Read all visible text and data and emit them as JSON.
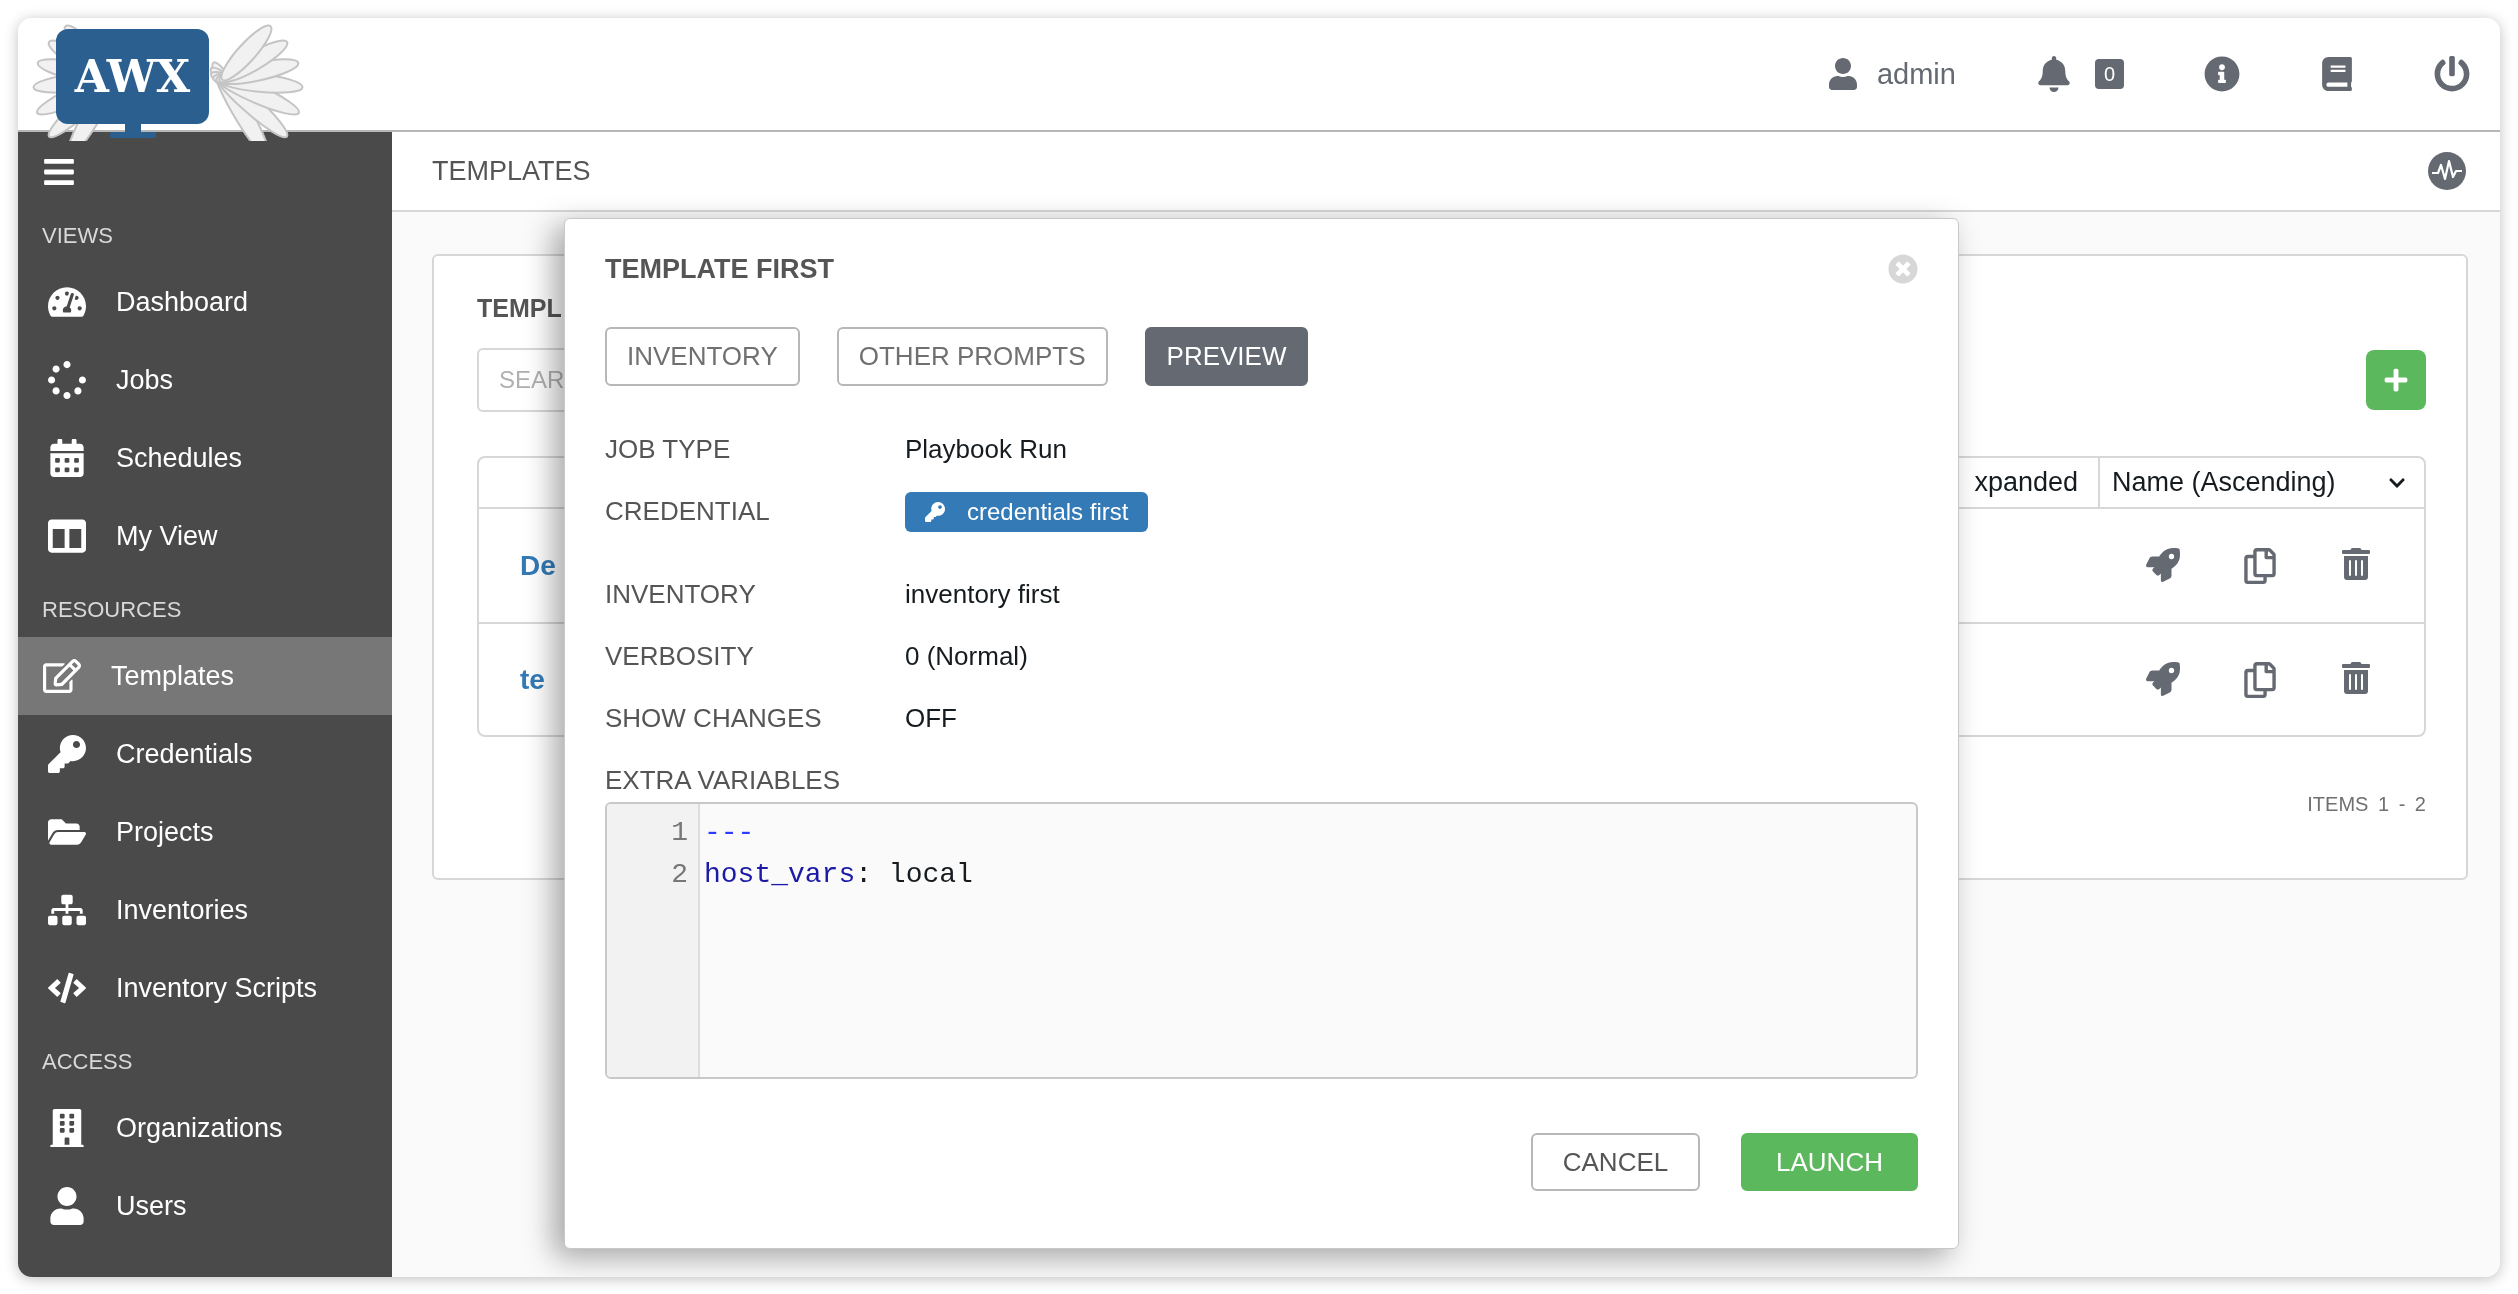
{
  "logo": {
    "text": "AWX"
  },
  "header": {
    "user": "admin",
    "notifications": "0"
  },
  "sidebar": {
    "sections": [
      {
        "title": "VIEWS",
        "items": [
          {
            "label": "Dashboard",
            "selected": false
          },
          {
            "label": "Jobs",
            "selected": false
          },
          {
            "label": "Schedules",
            "selected": false
          },
          {
            "label": "My View",
            "selected": false
          }
        ]
      },
      {
        "title": "RESOURCES",
        "items": [
          {
            "label": "Templates",
            "selected": true
          },
          {
            "label": "Credentials",
            "selected": false
          },
          {
            "label": "Projects",
            "selected": false
          },
          {
            "label": "Inventories",
            "selected": false
          },
          {
            "label": "Inventory Scripts",
            "selected": false
          }
        ]
      },
      {
        "title": "ACCESS",
        "items": [
          {
            "label": "Organizations",
            "selected": false
          },
          {
            "label": "Users",
            "selected": false
          }
        ]
      }
    ]
  },
  "breadcrumb": "TEMPLATES",
  "card": {
    "title": "TEMPL",
    "search": {
      "placeholder": "SEAR"
    },
    "list": {
      "column": "xpanded",
      "sort": "Name (Ascending)",
      "rows": [
        {
          "name": "De"
        },
        {
          "name": "te"
        }
      ]
    },
    "items_label": "ITEMS",
    "items_range": "1 - 2"
  },
  "modal": {
    "title": "TEMPLATE FIRST",
    "tabs": [
      {
        "label": "INVENTORY",
        "selected": false
      },
      {
        "label": "OTHER PROMPTS",
        "selected": false
      },
      {
        "label": "PREVIEW",
        "selected": true
      }
    ],
    "fields": [
      {
        "label": "JOB TYPE",
        "value": "Playbook Run",
        "kind": "text"
      },
      {
        "label": "CREDENTIAL",
        "value": "credentials first",
        "kind": "chip"
      },
      {
        "label": "INVENTORY",
        "value": "inventory first",
        "kind": "text"
      },
      {
        "label": "VERBOSITY",
        "value": "0 (Normal)",
        "kind": "text"
      },
      {
        "label": "SHOW CHANGES",
        "value": "OFF",
        "kind": "text"
      }
    ],
    "extra_variables": {
      "label": "EXTRA VARIABLES",
      "lines": [
        {
          "number": "1",
          "tokens": [
            {
              "text": "---",
              "kind": "marker"
            }
          ]
        },
        {
          "number": "2",
          "tokens": [
            {
              "text": "host_vars",
              "kind": "key"
            },
            {
              "text": ": local",
              "kind": "plain"
            }
          ]
        }
      ]
    },
    "buttons": [
      {
        "label": "CANCEL",
        "kind": "secondary"
      },
      {
        "label": "LAUNCH",
        "kind": "primary"
      }
    ]
  }
}
